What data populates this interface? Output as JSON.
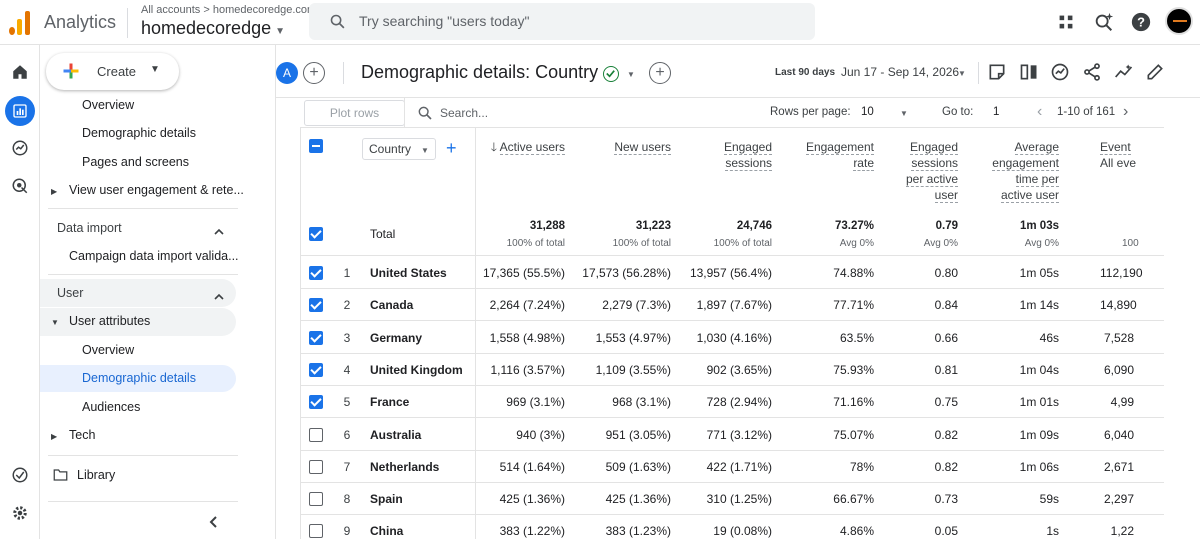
{
  "app": {
    "title": "Analytics",
    "breadcrumb": "All accounts > homedecoredge.com",
    "property": "homedecoredge"
  },
  "search": {
    "placeholder": "Try searching \"users today\""
  },
  "create": {
    "label": "Create"
  },
  "sidebar": {
    "items_top": [
      "Overview",
      "Demographic details",
      "Pages and screens"
    ],
    "engagement": "View user engagement & rete...",
    "data_import_header": "Data import",
    "campaign_import": "Campaign data import valida...",
    "user_header": "User",
    "user_attributes": "User attributes",
    "ua_items": [
      "Overview",
      "Demographic details",
      "Audiences"
    ],
    "tech": "Tech",
    "library": "Library"
  },
  "header": {
    "segment_letter": "A",
    "title": "Demographic details: Country",
    "date_label": "Last 90 days",
    "date_range": "Jun 17 - Sep 14, 2026"
  },
  "table": {
    "plot_rows": "Plot rows",
    "search_placeholder": "Search...",
    "rows_per_page_label": "Rows per page:",
    "rows_per_page": "10",
    "goto_label": "Go to:",
    "goto_value": "1",
    "range": "1-10 of 161",
    "dimension": "Country",
    "columns": [
      [
        "Active users"
      ],
      [
        "New users"
      ],
      [
        "Engaged",
        "sessions"
      ],
      [
        "Engagement",
        "rate"
      ],
      [
        "Engaged",
        "sessions",
        "per active",
        "user"
      ],
      [
        "Average",
        "engagement",
        "time per",
        "active user"
      ],
      [
        "Event",
        "All eve"
      ]
    ],
    "total_label": "Total",
    "totals": [
      {
        "value": "31,288",
        "sub": "100% of total"
      },
      {
        "value": "31,223",
        "sub": "100% of total"
      },
      {
        "value": "24,746",
        "sub": "100% of total"
      },
      {
        "value": "73.27%",
        "sub": "Avg 0%"
      },
      {
        "value": "0.79",
        "sub": "Avg 0%"
      },
      {
        "value": "1m 03s",
        "sub": "Avg 0%"
      },
      {
        "value": "",
        "sub": "100"
      }
    ],
    "rows": [
      {
        "idx": "1",
        "checked": true,
        "country": "United States",
        "cells": [
          "17,365 (55.5%)",
          "17,573 (56.28%)",
          "13,957 (56.4%)",
          "74.88%",
          "0.80",
          "1m 05s",
          "112,190"
        ]
      },
      {
        "idx": "2",
        "checked": true,
        "country": "Canada",
        "cells": [
          "2,264 (7.24%)",
          "2,279 (7.3%)",
          "1,897 (7.67%)",
          "77.71%",
          "0.84",
          "1m 14s",
          "14,890"
        ]
      },
      {
        "idx": "3",
        "checked": true,
        "country": "Germany",
        "cells": [
          "1,558 (4.98%)",
          "1,553 (4.97%)",
          "1,030 (4.16%)",
          "63.5%",
          "0.66",
          "46s",
          "7,528"
        ]
      },
      {
        "idx": "4",
        "checked": true,
        "country": "United Kingdom",
        "cells": [
          "1,116 (3.57%)",
          "1,109 (3.55%)",
          "902 (3.65%)",
          "75.93%",
          "0.81",
          "1m 04s",
          "6,090"
        ]
      },
      {
        "idx": "5",
        "checked": true,
        "country": "France",
        "cells": [
          "969 (3.1%)",
          "968 (3.1%)",
          "728 (2.94%)",
          "71.16%",
          "0.75",
          "1m 01s",
          "4,99"
        ]
      },
      {
        "idx": "6",
        "checked": false,
        "country": "Australia",
        "cells": [
          "940 (3%)",
          "951 (3.05%)",
          "771 (3.12%)",
          "75.07%",
          "0.82",
          "1m 09s",
          "6,040"
        ]
      },
      {
        "idx": "7",
        "checked": false,
        "country": "Netherlands",
        "cells": [
          "514 (1.64%)",
          "509 (1.63%)",
          "422 (1.71%)",
          "78%",
          "0.82",
          "1m 06s",
          "2,671"
        ]
      },
      {
        "idx": "8",
        "checked": false,
        "country": "Spain",
        "cells": [
          "425 (1.36%)",
          "425 (1.36%)",
          "310 (1.25%)",
          "66.67%",
          "0.73",
          "59s",
          "2,297"
        ]
      },
      {
        "idx": "9",
        "checked": false,
        "country": "China",
        "cells": [
          "383 (1.22%)",
          "383 (1.23%)",
          "19 (0.08%)",
          "4.86%",
          "0.05",
          "1s",
          "1,22"
        ]
      }
    ]
  },
  "colors": {
    "accent": "#1a73e8",
    "active_bg": "#e8f0fe",
    "active_text": "#1967d2",
    "logo_orange": "#f9ab00",
    "logo_dark": "#e37400"
  },
  "icons": [
    "search-icon",
    "apps-grid-icon",
    "insights-icon",
    "help-icon",
    "home-icon",
    "reports-icon",
    "explore-icon",
    "advertising-icon",
    "configure-icon",
    "settings-icon",
    "folder-icon"
  ]
}
